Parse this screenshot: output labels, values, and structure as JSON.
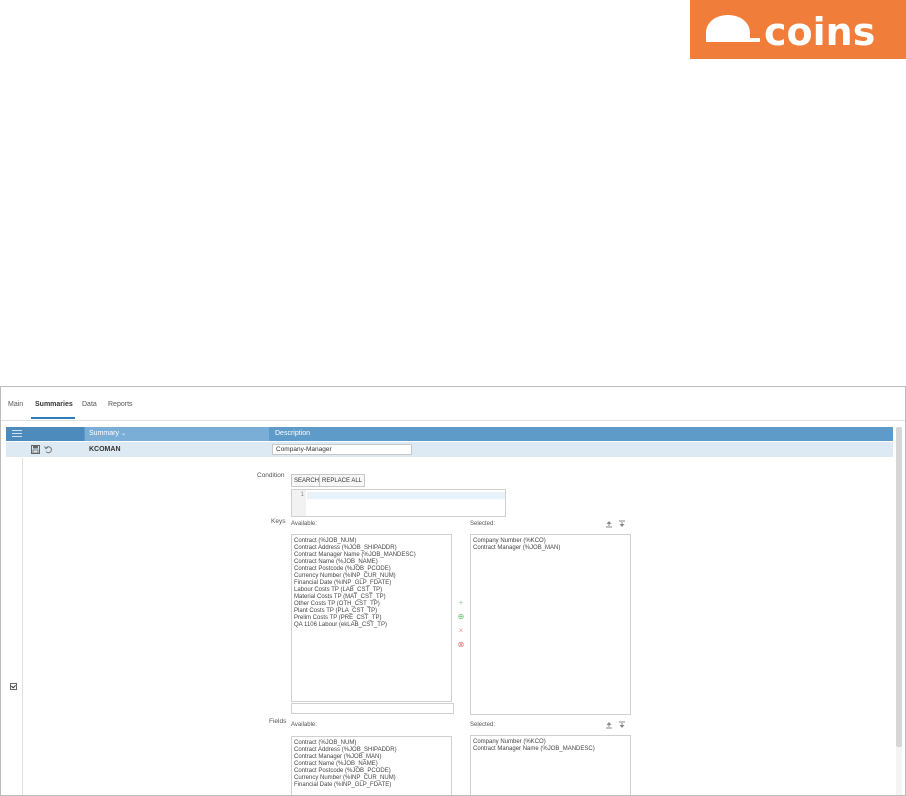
{
  "brand": {
    "name": "coins",
    "color": "#f07e3a"
  },
  "tabs": [
    {
      "label": "Main"
    },
    {
      "label": "Summaries"
    },
    {
      "label": "Data"
    },
    {
      "label": "Reports"
    }
  ],
  "active_tab": "Summaries",
  "grid": {
    "headers": {
      "summary": "Summary",
      "description": "Description"
    },
    "row": {
      "code": "KCOMAN",
      "description": "Company-Manager"
    }
  },
  "condition": {
    "label": "Condition",
    "search_label": "SEARCH",
    "replace_label": "REPLACE ALL",
    "line_number": "1"
  },
  "keys": {
    "label": "Keys",
    "available_label": "Available:",
    "selected_label": "Selected:",
    "available": [
      "Contract (%JOB_NUM)",
      "Contract Address (%JOB_SHIPADDR)",
      "Contract Manager Name (%JOB_MANDESC)",
      "Contract Name (%JOB_NAME)",
      "Contract Postcode (%JOB_PCODE)",
      "Currency Number (%INP_CUR_NUM)",
      "Financial Date (%INP_GLP_FDATE)",
      "Labour Costs TP (LAB_CST_TP)",
      "Material Costs TP (MAT_CST_TP)",
      "Other Costs TP (OTH_CST_TP)",
      "Plant Costs TP (PLA_CST_TP)",
      "Prelim Costs TP (PRE_CST_TP)",
      "QA 1106 Labour (ekLAB_CST_TP)"
    ],
    "selected": [
      "Company Number (%KCO)",
      "Contract Manager (%JOB_MAN)"
    ]
  },
  "fields": {
    "label": "Fields",
    "available_label": "Available:",
    "selected_label": "Selected:",
    "available": [
      "Contract (%JOB_NUM)",
      "Contract Address (%JOB_SHIPADDR)",
      "Contract Manager (%JOB_MAN)",
      "Contract Name (%JOB_NAME)",
      "Contract Postcode (%JOB_PCODE)",
      "Currency Number (%INP_CUR_NUM)",
      "Financial Date (%INP_GLP_FDATE)"
    ],
    "selected": [
      "Company Number (%KCO)",
      "Contract Manager Name (%JOB_MANDESC)"
    ]
  },
  "colors": {
    "header_blue": "#5e9bc9",
    "header_dark": "#4d8bbd",
    "sorted_col": "#7aaed6",
    "row_bg": "#deeaf3",
    "tab_underline": "#2d7ab8",
    "add_green": "#6cc070",
    "remove_red": "#e57373"
  },
  "icons": [
    "menu-icon",
    "save-icon",
    "undo-icon",
    "sort-arrow-icon",
    "add-icon",
    "add-all-icon",
    "remove-icon",
    "remove-all-icon",
    "move-top-icon",
    "move-bottom-icon",
    "checkbox-icon"
  ]
}
